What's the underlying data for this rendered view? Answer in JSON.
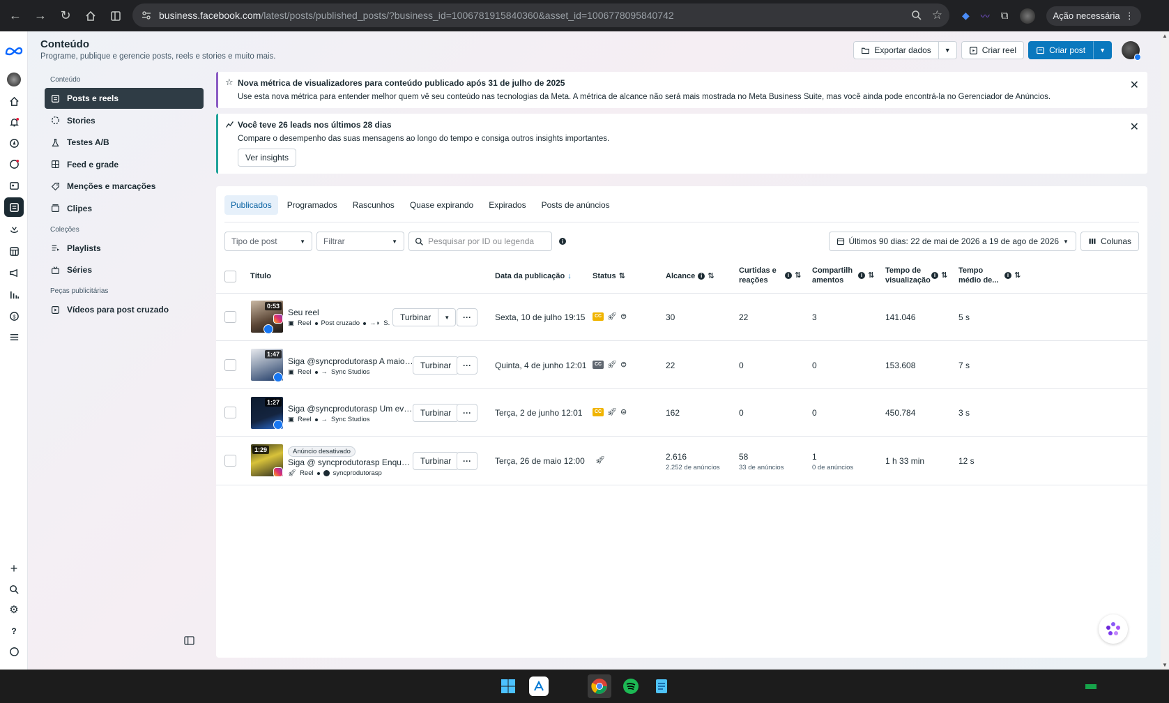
{
  "browser": {
    "url_host": "business.facebook.com",
    "url_path": "/latest/posts/published_posts/?business_id=1006781915840360&asset_id=1006778095840742",
    "profile_label": "Ação necessária"
  },
  "header": {
    "title": "Conteúdo",
    "subtitle": "Programe, publique e gerencie posts, reels e stories e muito mais.",
    "export_label": "Exportar dados",
    "create_reel_label": "Criar reel",
    "create_post_label": "Criar post"
  },
  "leftnav": {
    "section_content": "Conteúdo",
    "items": [
      {
        "label": "Posts e reels",
        "icon": "posts-icon"
      },
      {
        "label": "Stories",
        "icon": "stories-icon"
      },
      {
        "label": "Testes A/B",
        "icon": "flask-icon"
      },
      {
        "label": "Feed e grade",
        "icon": "grid-icon"
      },
      {
        "label": "Menções e marcações",
        "icon": "tag-icon"
      },
      {
        "label": "Clipes",
        "icon": "clip-icon"
      }
    ],
    "section_collections": "Coleções",
    "collections": [
      {
        "label": "Playlists",
        "icon": "playlist-icon"
      },
      {
        "label": "Séries",
        "icon": "series-icon"
      }
    ],
    "section_ads": "Peças publicitárias",
    "ads": [
      {
        "label": "Vídeos para post cruzado",
        "icon": "video-icon"
      }
    ]
  },
  "banners": {
    "metric": {
      "title": "Nova métrica de visualizadores para conteúdo publicado após 31 de julho de 2025",
      "text": "Use esta nova métrica para entender melhor quem vê seu conteúdo nas tecnologias da Meta. A métrica de alcance não será mais mostrada no Meta Business Suite, mas você ainda pode encontrá-la no Gerenciador de Anúncios."
    },
    "leads": {
      "title": "Você teve 26 leads nos últimos 28 dias",
      "text": "Compare o desempenho das suas mensagens ao longo do tempo e consiga outros insights importantes.",
      "button": "Ver insights"
    }
  },
  "tabs": [
    "Publicados",
    "Programados",
    "Rascunhos",
    "Quase expirando",
    "Expirados",
    "Posts de anúncios"
  ],
  "filters": {
    "post_type_placeholder": "Tipo de post",
    "filter_placeholder": "Filtrar",
    "search_placeholder": "Pesquisar por ID ou legenda",
    "date_range": "Últimos 90 dias: 22 de mai de 2026 a 19 de ago de 2026",
    "columns_label": "Colunas"
  },
  "table": {
    "headers": {
      "title": "Título",
      "date": "Data da publicação",
      "status": "Status",
      "reach": "Alcance",
      "likes_1": "Curtidas e",
      "likes_2": "reações",
      "shares_1": "Compartilh",
      "shares_2": "amentos",
      "watch_1": "Tempo de",
      "watch_2": "visualização",
      "avg_1": "Tempo",
      "avg_2": "médio de..."
    },
    "boost_label": "Turbinar",
    "more_label": "···",
    "rows": [
      {
        "duration": "0:53",
        "title": "Seu reel",
        "type": "Reel",
        "meta2": "Post cruzado",
        "meta3": "S.",
        "date": "Sexta, 10 de julho 19:15",
        "reach": "30",
        "likes": "22",
        "shares": "3",
        "watch": "141.046",
        "avg": "5 s"
      },
      {
        "duration": "1:47",
        "title": "Siga @syncprodutorasp A maioria das...",
        "type": "Reel",
        "meta3": "Sync Studios",
        "date": "Quinta, 4 de junho 12:01",
        "reach": "22",
        "likes": "0",
        "shares": "0",
        "watch": "153.608",
        "avg": "7 s"
      },
      {
        "duration": "1:27",
        "title": "Siga @syncprodutorasp Um evento d...",
        "type": "Reel",
        "meta3": "Sync Studios",
        "date": "Terça, 2 de junho 12:01",
        "reach": "162",
        "likes": "0",
        "shares": "0",
        "watch": "450.784",
        "avg": "3 s"
      },
      {
        "duration": "1:29",
        "badge": "Anúncio desativado",
        "title": "Siga @ syncprodutorasp Enquanto m...",
        "type": "Reel",
        "meta3": "syncprodutorasp",
        "date": "Terça, 26 de maio 12:00",
        "reach": "2.616",
        "reach_sub": "2.252 de anúncios",
        "likes": "58",
        "likes_sub": "33 de anúncios",
        "shares": "1",
        "shares_sub": "0 de anúncios",
        "watch": "1 h 33 min",
        "avg": "12 s"
      }
    ]
  },
  "colors": {
    "primary": "#0a78be",
    "nav_active": "#2f3c45",
    "cc_yellow": "#f0b400",
    "cc_gray": "#606770"
  }
}
